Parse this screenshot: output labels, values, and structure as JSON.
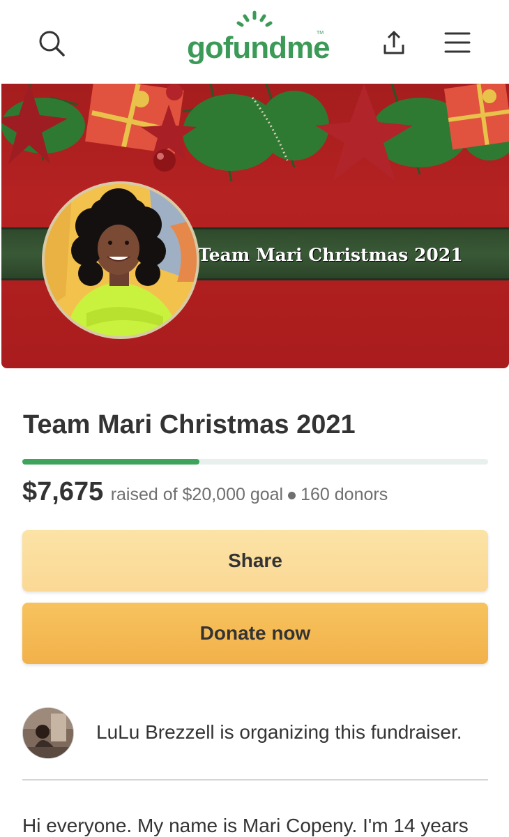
{
  "header": {
    "logo_text": "gofundme",
    "logo_mark": "TM",
    "icons": [
      "search-icon",
      "share-icon",
      "menu-icon"
    ]
  },
  "banner": {
    "ribbon_text": "Team Mari Christmas 2021"
  },
  "campaign": {
    "title": "Team Mari Christmas 2021",
    "amount_raised": "$7,675",
    "goal_text": "raised of $20,000 goal",
    "donors_text": "160 donors",
    "progress_fraction": 0.38
  },
  "actions": {
    "share_label": "Share",
    "donate_label": "Donate now"
  },
  "organizer": {
    "text": "LuLu Brezzell is organizing this fundraiser."
  },
  "story": {
    "first_line": "Hi everyone. My name is Mari Copeny. I'm 14 years"
  },
  "colors": {
    "brand_green": "#3b9a57",
    "progress_fill": "#3ea35b",
    "share_button": "#fbdc9c",
    "donate_button": "#f4b952",
    "banner_red": "#a91c1d",
    "ribbon_green": "#395936"
  }
}
